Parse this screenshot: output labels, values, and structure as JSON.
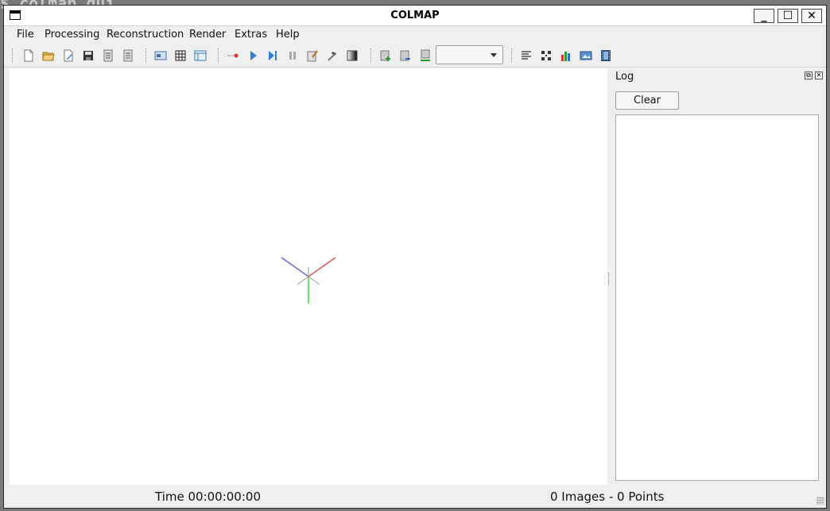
{
  "background": {
    "terminal_text": "$ colmap gui"
  },
  "window": {
    "title": "COLMAP"
  },
  "window_controls": {
    "minimize": "_",
    "maximize": "☐",
    "close": "✕"
  },
  "menu": {
    "items": [
      "File",
      "Processing",
      "Reconstruction",
      "Render",
      "Extras",
      "Help"
    ]
  },
  "toolbar": {
    "combo_value": "",
    "icons": [
      "new-project-icon",
      "open-project-icon",
      "edit-project-icon",
      "save-project-icon",
      "import-model-icon",
      "export-model-icon",
      "feature-extraction-icon",
      "feature-matching-icon",
      "database-management-icon",
      "reconstruction-start-icon",
      "play-icon",
      "step-icon",
      "pause-icon",
      "bundle-adjustment-icon",
      "hammer-icon",
      "render-icon",
      "add-model-icon",
      "load-model-icon",
      "remove-model-icon",
      "reconstruction-stats-icon",
      "match-matrix-icon",
      "bar-chart-icon",
      "screenshot-icon",
      "movie-icon"
    ]
  },
  "dock": {
    "title": "Log",
    "clear_label": "Clear",
    "float_symbol": "⧉",
    "close_symbol": "✕"
  },
  "status": {
    "time": "Time 00:00:00:00",
    "counts": "0 Images - 0 Points"
  },
  "colors": {
    "axis_x": "#e05555",
    "axis_y": "#33dd33",
    "axis_z": "#6666dd"
  }
}
